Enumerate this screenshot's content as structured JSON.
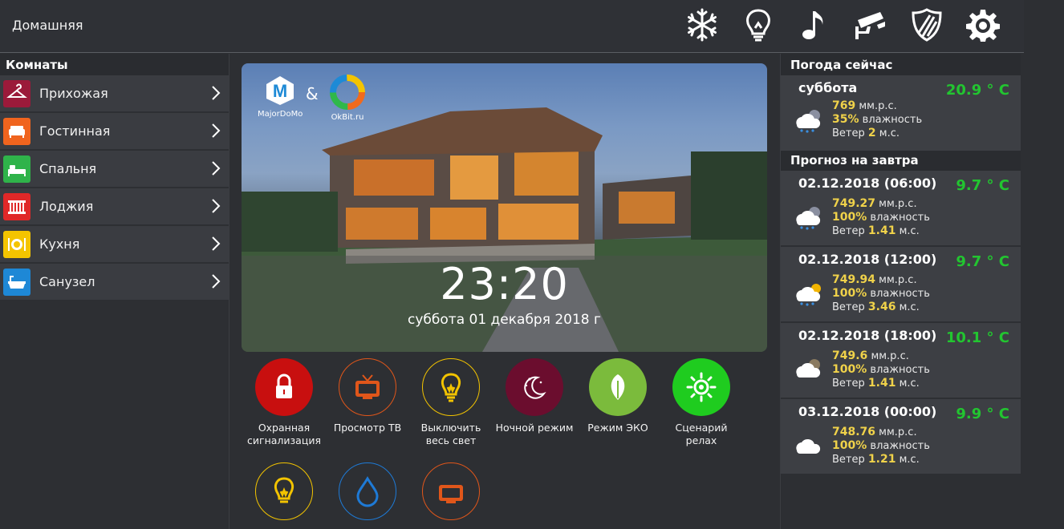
{
  "header": {
    "title": "Домашняя"
  },
  "top_icons": [
    "snowflake-icon",
    "lightbulb-icon",
    "music-note-icon",
    "security-camera-icon",
    "shield-icon",
    "gear-icon"
  ],
  "rooms": {
    "heading": "Комнаты",
    "items": [
      {
        "label": "Прихожая",
        "icon": "hanger-icon",
        "color": "#9b1a3a"
      },
      {
        "label": "Гостинная",
        "icon": "sofa-icon",
        "color": "#f0641e"
      },
      {
        "label": "Спальня",
        "icon": "bed-icon",
        "color": "#2fb34a"
      },
      {
        "label": "Лоджия",
        "icon": "radiator-icon",
        "color": "#e02828"
      },
      {
        "label": "Кухня",
        "icon": "plate-icon",
        "color": "#f4c400"
      },
      {
        "label": "Санузел",
        "icon": "bathtub-icon",
        "color": "#1e88d6"
      }
    ]
  },
  "hero": {
    "logo_left": "MajorDoMo",
    "logo_right": "OkBit.ru",
    "amp": "&",
    "time": "23:20",
    "date": "суббота 01 декабря 2018 г"
  },
  "scenes": [
    {
      "label": "Охранная сигнализация",
      "icon": "padlock-icon",
      "color": "#c80f0f",
      "style": "filled"
    },
    {
      "label": "Просмотр ТВ",
      "icon": "tv-icon",
      "color": "#e0561a",
      "style": "outline"
    },
    {
      "label": "Выключить весь свет",
      "icon": "lightbulb-icon",
      "color": "#f2c300",
      "style": "outline"
    },
    {
      "label": "Ночной режим",
      "icon": "moon-stars-icon",
      "color": "#6b0d2e",
      "style": "filled"
    },
    {
      "label": "Режим ЭКО",
      "icon": "leaf-icon",
      "color": "#7bbb3c",
      "style": "filled"
    },
    {
      "label": "Сценарий релах",
      "icon": "sun-icon",
      "color": "#1fcc1f",
      "style": "filled"
    },
    {
      "label": "",
      "icon": "lightbulb-icon",
      "color": "#f2c300",
      "style": "outline"
    },
    {
      "label": "",
      "icon": "water-drop-icon",
      "color": "#1e7ad6",
      "style": "outline"
    },
    {
      "label": "",
      "icon": "tv-icon",
      "color": "#e0561a",
      "style": "outline"
    }
  ],
  "weather_now": {
    "heading": "Погода сейчас",
    "day": "суббота",
    "temp": "20.9 ° C",
    "pressure": "769",
    "pressure_unit": "мм.р.с.",
    "humidity": "35%",
    "humidity_label": "влажность",
    "wind_label": "Ветер",
    "wind": "2",
    "wind_unit": "м.с.",
    "icon": "cloud-rain-night-icon"
  },
  "forecast": {
    "heading": "Прогноз на завтра",
    "items": [
      {
        "date": "02.12.2018 (06:00)",
        "temp": "9.7 ° C",
        "pressure": "749.27",
        "humidity": "100%",
        "wind": "1.41",
        "icon": "cloud-rain-night-icon"
      },
      {
        "date": "02.12.2018 (12:00)",
        "temp": "9.7 ° C",
        "pressure": "749.94",
        "humidity": "100%",
        "wind": "3.46",
        "icon": "cloud-rain-sun-icon"
      },
      {
        "date": "02.12.2018 (18:00)",
        "temp": "10.1 ° C",
        "pressure": "749.6",
        "humidity": "100%",
        "wind": "1.41",
        "icon": "cloud-night-icon"
      },
      {
        "date": "03.12.2018 (00:00)",
        "temp": "9.9 ° C",
        "pressure": "748.76",
        "humidity": "100%",
        "wind": "1.21",
        "icon": "cloud-icon"
      }
    ],
    "pressure_unit": "мм.р.с.",
    "humidity_label": "влажность",
    "wind_label": "Ветер",
    "wind_unit": "м.с."
  }
}
